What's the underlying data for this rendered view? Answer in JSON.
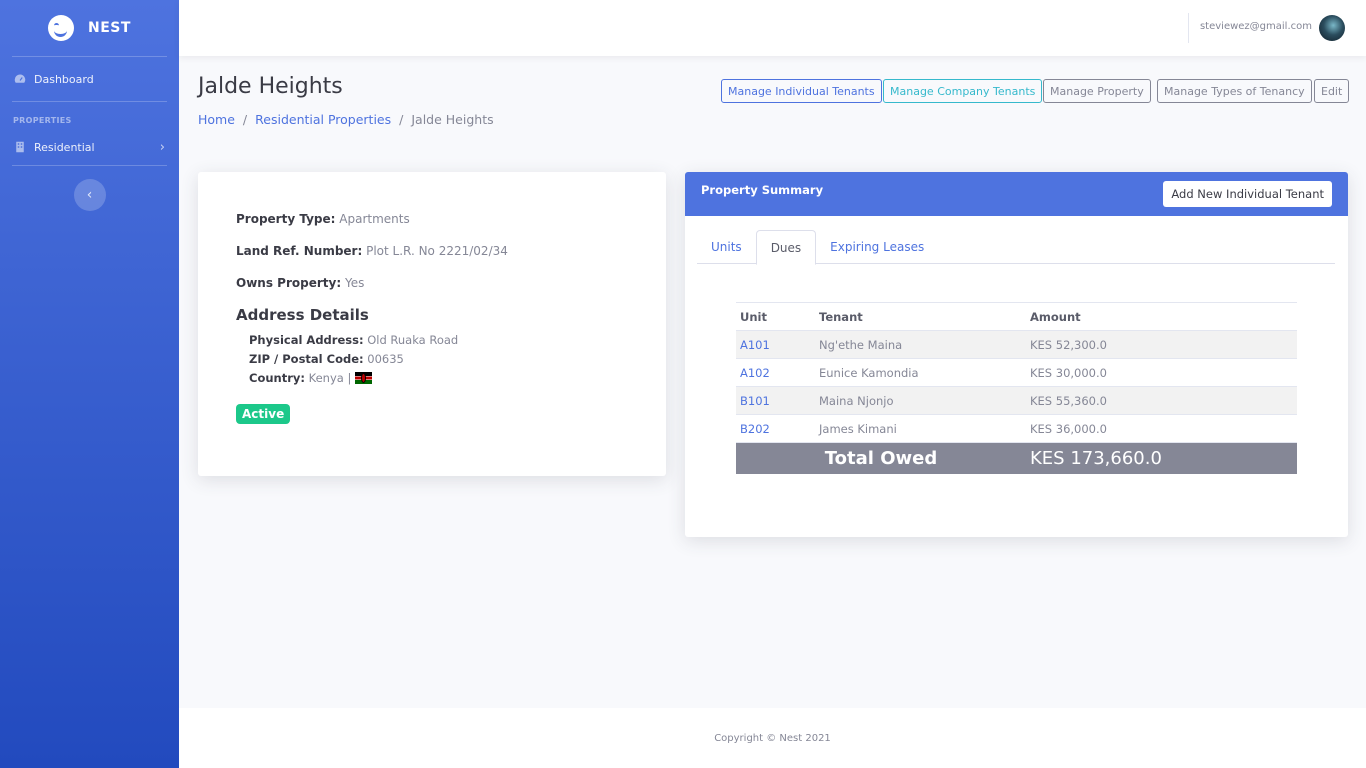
{
  "brand": {
    "name": "NEST",
    "logo_icon": "smiley-logo-icon"
  },
  "sidebar": {
    "dashboard_label": "Dashboard",
    "section_heading": "PROPERTIES",
    "residential_label": "Residential",
    "collapse_icon": "chevron-left-icon"
  },
  "topbar": {
    "user_email": "steviewez@gmail.com"
  },
  "page": {
    "title": "Jalde Heights",
    "breadcrumb": [
      "Home",
      "Residential Properties",
      "Jalde Heights"
    ],
    "breadcrumb_sep": "/"
  },
  "actions": {
    "individual": "Manage Individual Tenants",
    "company": "Manage Company Tenants",
    "property": "Manage Property",
    "tenancy": "Manage Types of Tenancy",
    "edit": "Edit"
  },
  "details": {
    "property_type_label": "Property Type:",
    "property_type": "Apartments",
    "land_ref_label": "Land Ref. Number:",
    "land_ref": "Plot L.R. No 2221/02/34",
    "owns_label": "Owns Property:",
    "owns": "Yes",
    "address_heading": "Address Details",
    "physical_label": "Physical Address:",
    "physical": "Old Ruaka Road",
    "zip_label": "ZIP / Postal Code:",
    "zip": "00635",
    "country_label": "Country:",
    "country": "Kenya |",
    "status": "Active"
  },
  "summary": {
    "title": "Property Summary",
    "add_button": "Add New Individual Tenant",
    "tabs": [
      "Units",
      "Dues",
      "Expiring Leases"
    ],
    "active_tab": "Dues",
    "columns": [
      "Unit",
      "Tenant",
      "Amount"
    ],
    "rows": [
      {
        "unit": "A101",
        "tenant": "Ng'ethe Maina",
        "amount": "KES 52,300.0"
      },
      {
        "unit": "A102",
        "tenant": "Eunice Kamondia",
        "amount": "KES 30,000.0"
      },
      {
        "unit": "B101",
        "tenant": "Maina Njonjo",
        "amount": "KES 55,360.0"
      },
      {
        "unit": "B202",
        "tenant": "James Kimani",
        "amount": "KES 36,000.0"
      }
    ],
    "total_label": "Total Owed",
    "total_amount": "KES 173,660.0"
  },
  "footer": {
    "copyright": "Copyright © Nest 2021"
  },
  "colors": {
    "primary": "#4e73df",
    "info": "#36b9cc",
    "success": "#1cc88a",
    "secondary": "#858796"
  }
}
